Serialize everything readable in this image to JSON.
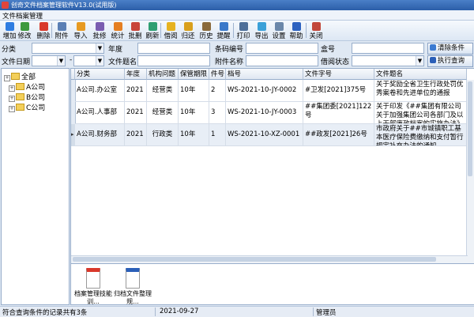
{
  "window": {
    "title": "创奇文件档案管理软件V13.0(试用版)"
  },
  "menu": {
    "label": "文件档案管理"
  },
  "toolbar": {
    "items": [
      {
        "label": "增加",
        "icon": "plus-icon",
        "color": "#2f7de1"
      },
      {
        "label": "修改",
        "icon": "edit-icon",
        "color": "#3d9a3d"
      },
      {
        "label": "删除",
        "icon": "delete-icon",
        "color": "#d93a2b"
      },
      {
        "label": "附件",
        "icon": "attach-icon",
        "color": "#5a7fb5"
      },
      {
        "label": "导入",
        "icon": "import-icon",
        "color": "#e79a21"
      },
      {
        "label": "批修",
        "icon": "batch-edit-icon",
        "color": "#7a5db0"
      },
      {
        "label": "统计",
        "icon": "stats-icon",
        "color": "#e57f22"
      },
      {
        "label": "批删",
        "icon": "batch-delete-icon",
        "color": "#c9453a"
      },
      {
        "label": "刷新",
        "icon": "refresh-icon",
        "color": "#2e9f72"
      },
      {
        "label": "借阅",
        "icon": "borrow-icon",
        "color": "#e6b21f"
      },
      {
        "label": "归还",
        "icon": "return-icon",
        "color": "#d9a01c"
      },
      {
        "label": "历史",
        "icon": "history-icon",
        "color": "#8a6a3b"
      },
      {
        "label": "提醒",
        "icon": "clock-icon",
        "color": "#3a78c9"
      },
      {
        "label": "打印",
        "icon": "print-icon",
        "color": "#4e6f99"
      },
      {
        "label": "导出",
        "icon": "export-icon",
        "color": "#3aa0d8"
      },
      {
        "label": "设置",
        "icon": "gear-icon",
        "color": "#6b87a9"
      },
      {
        "label": "帮助",
        "icon": "help-icon",
        "color": "#2d62c0"
      },
      {
        "label": "关闭",
        "icon": "close-icon",
        "color": "#c2473a"
      }
    ]
  },
  "query": {
    "category_label": "分类",
    "year_label": "年度",
    "barcode_label": "条码编号",
    "box_label": "盒号",
    "clear_button": "清除条件",
    "file_date_label": "文件日期",
    "date_separator": "-",
    "file_title_label": "文件题名",
    "attachment_name_label": "附件名称",
    "borrow_status_label": "借阅状态",
    "search_button": "执行查询"
  },
  "tree": {
    "root": "全部",
    "children": [
      "A公司",
      "B公司",
      "C公司"
    ]
  },
  "table": {
    "columns": [
      "分类",
      "年度",
      "机构问题",
      "保管期限",
      "件号",
      "档号",
      "文件字号",
      "文件题名"
    ],
    "rows": [
      {
        "cat": "A公司.办公室",
        "year": "2021",
        "org": "经营类",
        "term": "10年",
        "num": "2",
        "code": "WS-2021-10-JY-0002",
        "ref": "#卫发[2021]375号",
        "title": "关于奖励全省卫生行政处罚优秀案卷和先进单位的通报"
      },
      {
        "cat": "A公司.人事部",
        "year": "2021",
        "org": "经营类",
        "term": "10年",
        "num": "3",
        "code": "WS-2021-10-JY-0003",
        "ref": "##集团委[2021]122号",
        "title": "关于印发《##集团有限公司关于加强集团公司各部门及以上干部廉政档案的实施办法》的通知"
      },
      {
        "cat": "A公司.财务部",
        "year": "2021",
        "org": "行政类",
        "term": "10年",
        "num": "1",
        "code": "WS-2021-10-XZ-0001",
        "ref": "##政发[2021]26号",
        "title": "市政府关于##市城镇职工基本医疗保险费缴纳和支付暂行规定补充办法的通知"
      }
    ]
  },
  "attachments": [
    {
      "label": "档案管理技能训...",
      "icon": "pdf-icon",
      "color": "#d9382b"
    },
    {
      "label": "归档文件整理规...",
      "icon": "word-icon",
      "color": "#2b5fb8"
    }
  ],
  "status": {
    "records": "符合查询条件的记录共有3条",
    "date": "2021-09-27",
    "user": "管理员"
  }
}
